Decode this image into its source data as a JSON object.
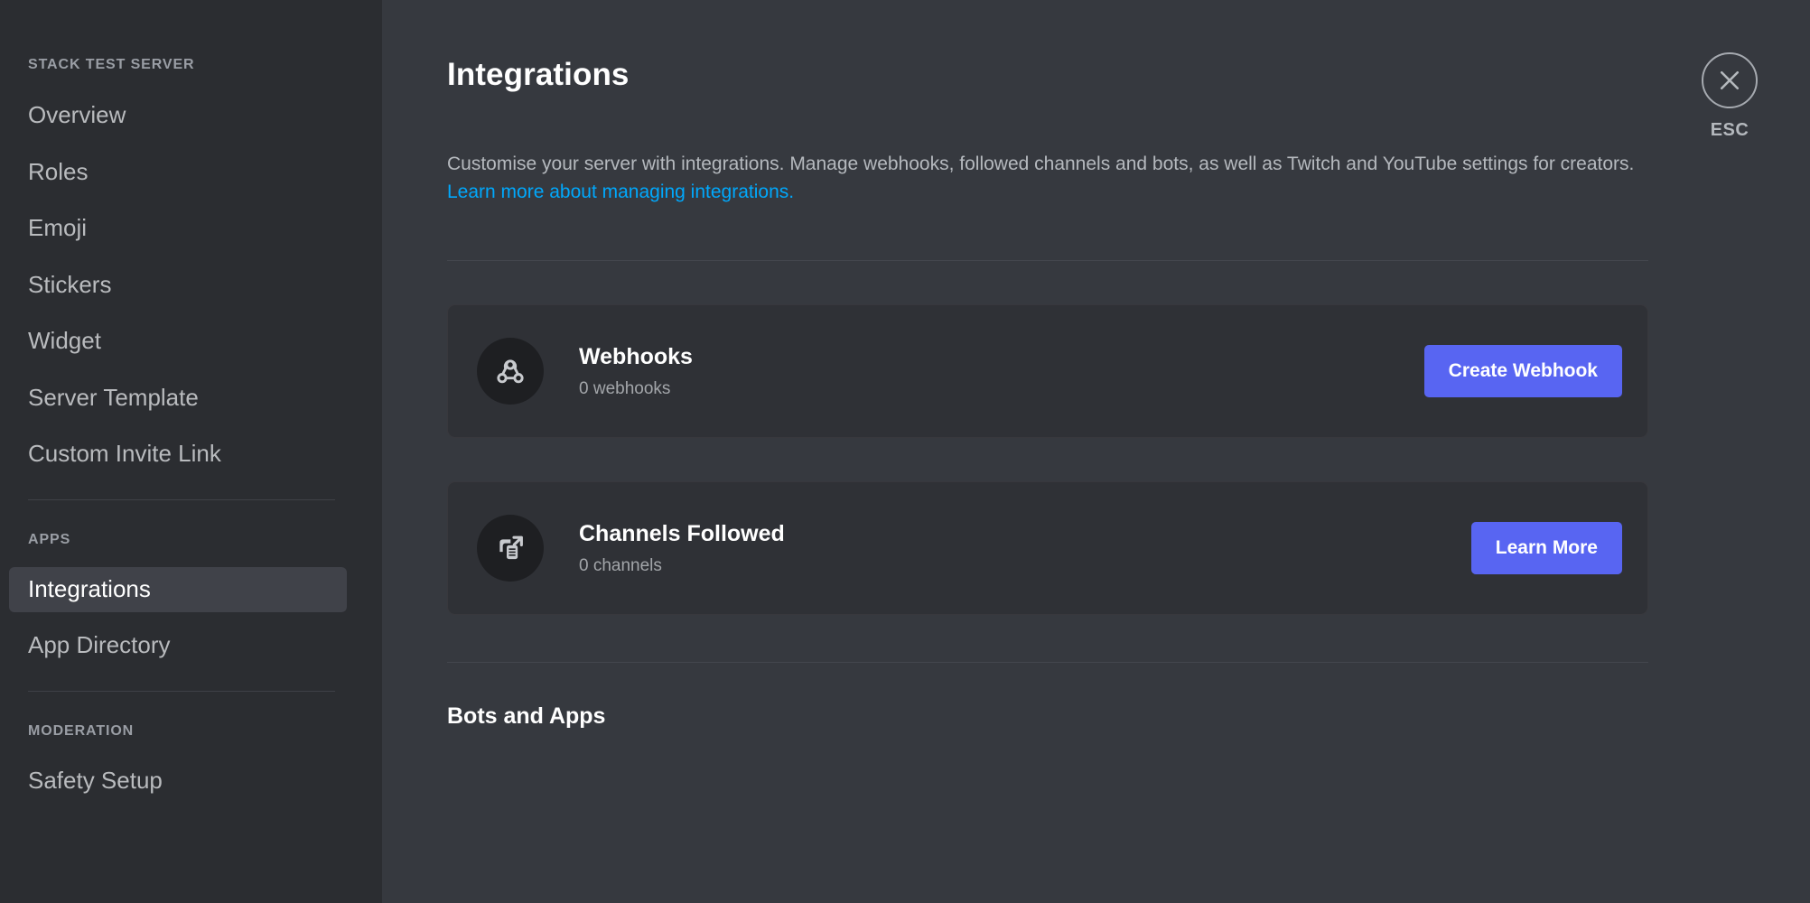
{
  "sidebar": {
    "server_name": "STACK TEST SERVER",
    "groups": [
      {
        "header": null,
        "items": [
          {
            "label": "Overview",
            "selected": false
          },
          {
            "label": "Roles",
            "selected": false
          },
          {
            "label": "Emoji",
            "selected": false
          },
          {
            "label": "Stickers",
            "selected": false
          },
          {
            "label": "Widget",
            "selected": false
          },
          {
            "label": "Server Template",
            "selected": false
          },
          {
            "label": "Custom Invite Link",
            "selected": false
          }
        ]
      },
      {
        "header": "APPS",
        "items": [
          {
            "label": "Integrations",
            "selected": true
          },
          {
            "label": "App Directory",
            "selected": false
          }
        ]
      },
      {
        "header": "MODERATION",
        "items": [
          {
            "label": "Safety Setup",
            "selected": false
          }
        ]
      }
    ]
  },
  "main": {
    "title": "Integrations",
    "description_part1": "Customise your server with integrations. Manage webhooks, followed channels and bots, as well as Twitch and YouTube settings for creators. ",
    "description_link": "Learn more about managing integrations.",
    "cards": [
      {
        "icon": "webhook-icon",
        "title": "Webhooks",
        "subtitle": "0 webhooks",
        "button_label": "Create Webhook"
      },
      {
        "icon": "channels-followed-icon",
        "title": "Channels Followed",
        "subtitle": "0 channels",
        "button_label": "Learn More"
      }
    ],
    "section_bots_and_apps": "Bots and Apps"
  },
  "close": {
    "label": "ESC",
    "icon": "close-icon"
  },
  "colors": {
    "sidebar_bg": "#2b2d31",
    "content_bg": "#36393f",
    "card_bg": "#2f3136",
    "accent_blurple": "#5865f2",
    "link_blue": "#00a8fc",
    "selected_item_bg": "#404249"
  }
}
